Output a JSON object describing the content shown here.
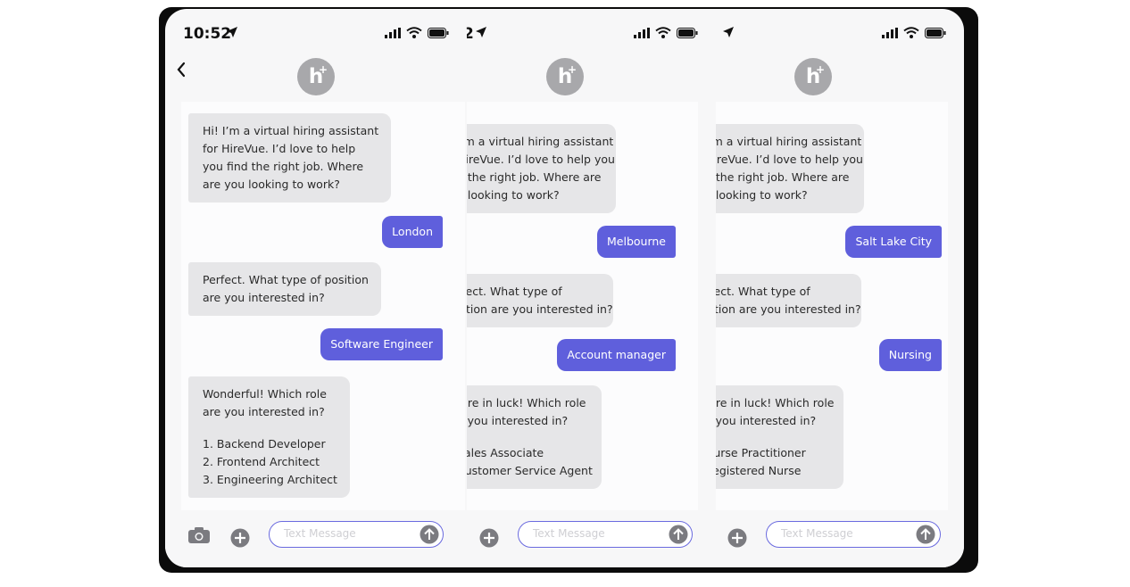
{
  "colors": {
    "accent": "#5f5fdc",
    "incoming_bubble": "#e6e6e8",
    "avatar": "#a8a8ab"
  },
  "icons": [
    "location-arrow-icon",
    "signal-icon",
    "wifi-icon",
    "battery-icon",
    "back-chevron-icon",
    "camera-icon",
    "add-icon",
    "send-arrow-icon",
    "hirevue-logo-icon"
  ],
  "avatar": {
    "letter": "h",
    "plus": "+"
  },
  "composer": {
    "placeholder": "Text Message"
  },
  "phones": [
    {
      "time": "10:52",
      "bubbles": [
        {
          "lines": [
            "Hi! I’m a virtual hiring assistant",
            "for HireVue. I’d love to help",
            "you find the right job. Where",
            "are you looking to work?"
          ]
        },
        {
          "text": "London"
        },
        {
          "lines": [
            "Perfect. What type of position",
            "are you interested in?"
          ]
        },
        {
          "text": "Software Engineer"
        },
        {
          "lines": [
            "Wonderful! Which role",
            "are you interested in?",
            "",
            "1. Backend Developer",
            "2. Frontend Architect",
            "3. Engineering Architect"
          ]
        }
      ]
    },
    {
      "time": "2",
      "bubbles": [
        {
          "lines": [
            "I’m a virtual hiring assistant",
            "HireVue. I’d love to help you",
            "d the right job. Where are",
            "u looking to work?"
          ]
        },
        {
          "text": "Melbourne"
        },
        {
          "lines": [
            "rfect. What type of",
            "sition are you interested in?"
          ]
        },
        {
          "text": "Account manager"
        },
        {
          "lines": [
            "u’re in luck! Which role",
            "e you interested in?",
            "",
            "Sales Associate",
            "Customer Service Agent"
          ]
        }
      ]
    },
    {
      "time": "",
      "bubbles": [
        {
          "lines": [
            "I’m a virtual hiring assistant",
            "HireVue. I’d love to help you",
            "d the right job. Where are",
            "u looking to work?"
          ]
        },
        {
          "text": "Salt Lake City"
        },
        {
          "lines": [
            "rfect. What type of",
            "sition are you interested in?"
          ]
        },
        {
          "text": "Nursing"
        },
        {
          "lines": [
            "u’re in luck! Which role",
            "e you interested in?",
            "",
            "Nurse Practitioner",
            "Registered Nurse"
          ]
        }
      ]
    }
  ]
}
